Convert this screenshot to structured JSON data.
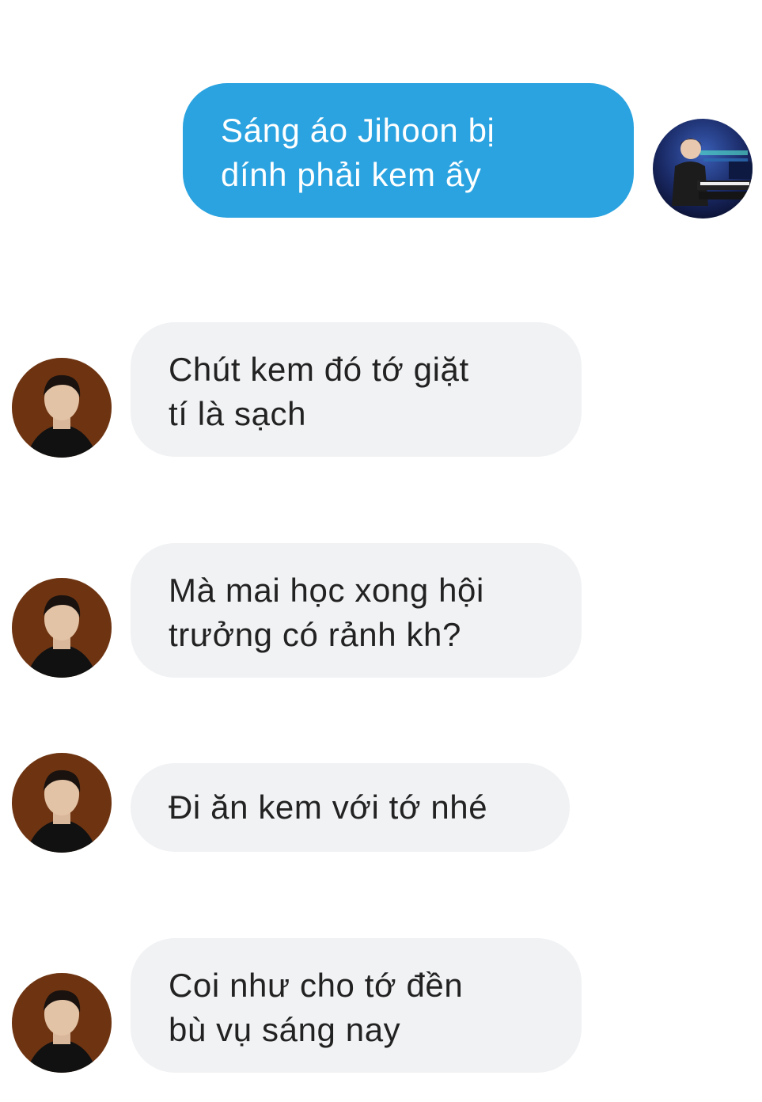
{
  "conversation": {
    "messages": [
      {
        "direction": "outgoing",
        "text": "Sáng áo Jihoon bị\ndính phải kem ấy",
        "avatar_icon": "pianist-avatar-icon"
      },
      {
        "direction": "incoming",
        "text": "Chút kem đó tớ giặt\ntí là sạch",
        "avatar_icon": "contact-avatar-icon"
      },
      {
        "direction": "incoming",
        "text": "Mà mai học xong hội\ntrưởng có rảnh kh?",
        "avatar_icon": "contact-avatar-icon"
      },
      {
        "direction": "incoming",
        "text": "Đi ăn kem với tớ nhé",
        "avatar_icon": "contact-avatar-icon"
      },
      {
        "direction": "incoming",
        "text": "Coi như cho tớ đền\nbù vụ sáng nay",
        "avatar_icon": "contact-avatar-icon"
      }
    ]
  },
  "colors": {
    "outgoing_bubble": "#2aa3e0",
    "incoming_bubble": "#f1f2f4",
    "outgoing_text": "#ffffff",
    "incoming_text": "#222222"
  }
}
